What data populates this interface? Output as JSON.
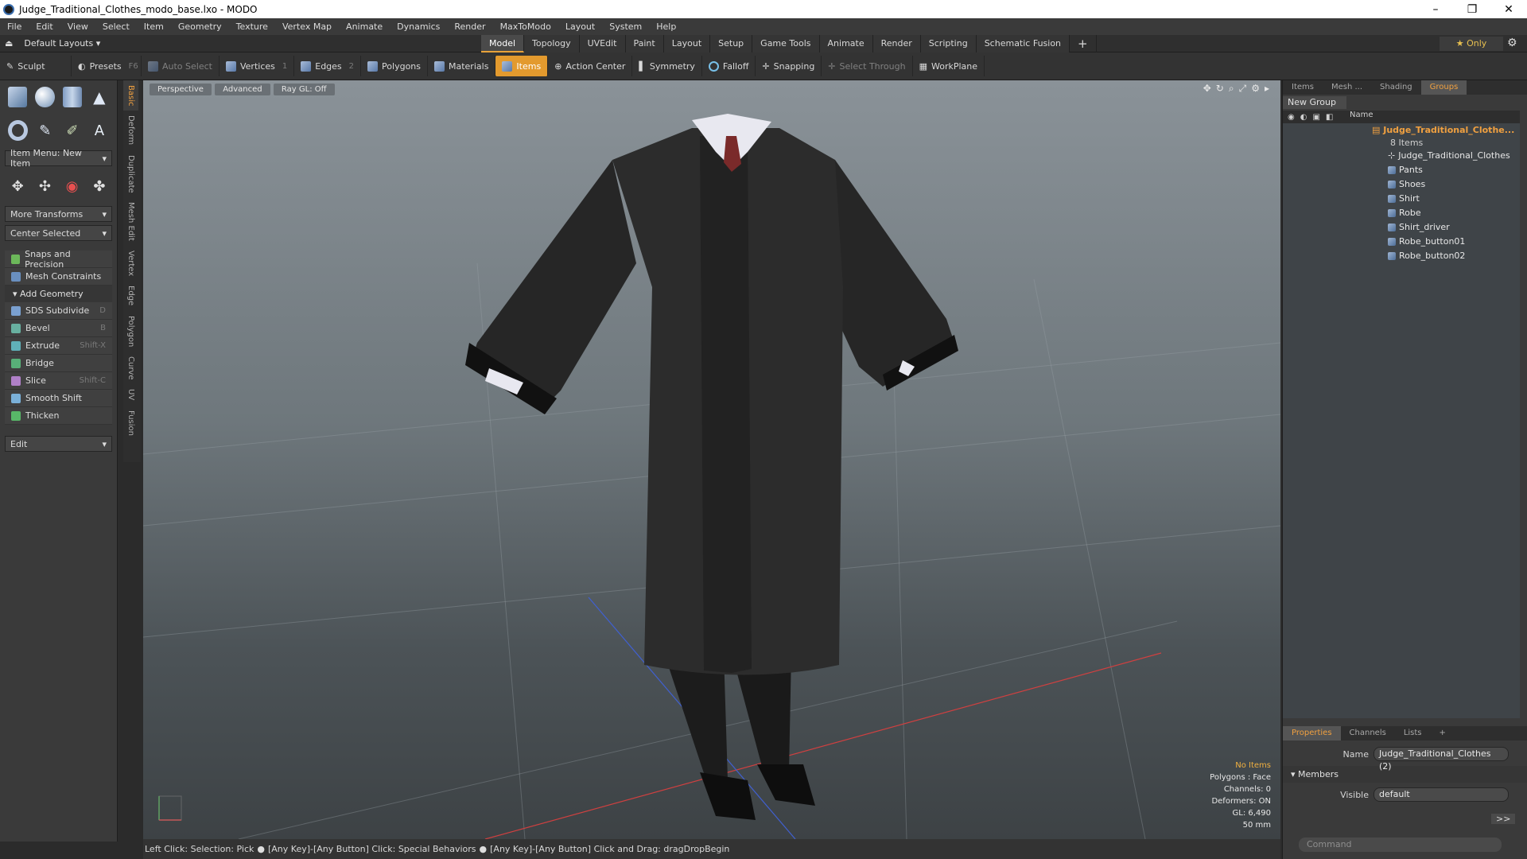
{
  "window": {
    "title": "Judge_Traditional_Clothes_modo_base.lxo - MODO",
    "controls": [
      "–",
      "❐",
      "✕"
    ]
  },
  "menu": [
    "File",
    "Edit",
    "View",
    "Select",
    "Item",
    "Geometry",
    "Texture",
    "Vertex Map",
    "Animate",
    "Dynamics",
    "Render",
    "MaxToModo",
    "Layout",
    "System",
    "Help"
  ],
  "layout_bar": {
    "layout_name": "Default Layouts ▾",
    "tabs": [
      "Model",
      "Topology",
      "UVEdit",
      "Paint",
      "Layout",
      "Setup",
      "Game Tools",
      "Animate",
      "Render",
      "Scripting",
      "Schematic Fusion"
    ],
    "active_tab": "Model",
    "plus": "+",
    "only": "★ Only"
  },
  "toolbar": {
    "sculpt": "Sculpt",
    "presets": "Presets",
    "presets_key": "F6",
    "auto_select": "Auto Select",
    "vertices": "Vertices",
    "vertices_key": "1",
    "edges": "Edges",
    "edges_key": "2",
    "polygons": "Polygons",
    "materials": "Materials",
    "items": "Items",
    "action_center": "Action Center",
    "symmetry": "Symmetry",
    "falloff": "Falloff",
    "snapping": "Snapping",
    "select_through": "Select Through",
    "workplane": "WorkPlane"
  },
  "left_panel": {
    "item_menu": "Item Menu: New Item",
    "more_transforms": "More Transforms",
    "center_selected": "Center Selected",
    "snaps": "Snaps and Precision",
    "mesh_constraints": "Mesh Constraints",
    "add_geometry": "Add Geometry",
    "tools": [
      {
        "label": "SDS Subdivide",
        "key": "D"
      },
      {
        "label": "Bevel",
        "key": "B"
      },
      {
        "label": "Extrude",
        "key": "Shift-X"
      },
      {
        "label": "Bridge",
        "key": ""
      },
      {
        "label": "Slice",
        "key": "Shift-C"
      },
      {
        "label": "Smooth Shift",
        "key": ""
      },
      {
        "label": "Thicken",
        "key": ""
      }
    ],
    "edit": "Edit",
    "vertical_tabs": [
      "Basic",
      "Deform",
      "Duplicate",
      "Mesh Edit",
      "Vertex",
      "Edge",
      "Polygon",
      "Curve",
      "UV",
      "Fusion"
    ]
  },
  "viewport": {
    "perspective": "Perspective",
    "advanced": "Advanced",
    "raygl": "Ray GL: Off",
    "stats": {
      "no_items": "No Items",
      "polygons": "Polygons : Face",
      "channels": "Channels: 0",
      "deformers": "Deformers: ON",
      "gl": "GL: 6,490",
      "scale": "50 mm"
    }
  },
  "statusbar": {
    "left": "Left Click: Selection: Pick",
    "middle": "[Any Key]-[Any Button] Click: Special Behaviors",
    "right": "[Any Key]-[Any Button] Click and Drag: dragDropBegin"
  },
  "right_panel": {
    "tabs": [
      "Items",
      "Mesh ...",
      "Shading",
      "Groups"
    ],
    "active_tab": "Groups",
    "new_group": "New Group",
    "name_header": "Name",
    "root": "Judge_Traditional_Clothe...",
    "root_count": "8 Items",
    "children": [
      "Judge_Traditional_Clothes",
      "Pants",
      "Shoes",
      "Shirt",
      "Robe",
      "Shirt_driver",
      "Robe_button01",
      "Robe_button02"
    ],
    "props_tabs": [
      "Properties",
      "Channels",
      "Lists",
      "+"
    ],
    "name_label": "Name",
    "name_value": "Judge_Traditional_Clothes (2)",
    "members": "Members",
    "visible_label": "Visible",
    "visible_value": "default",
    "more": ">>",
    "command_placeholder": "Command"
  }
}
